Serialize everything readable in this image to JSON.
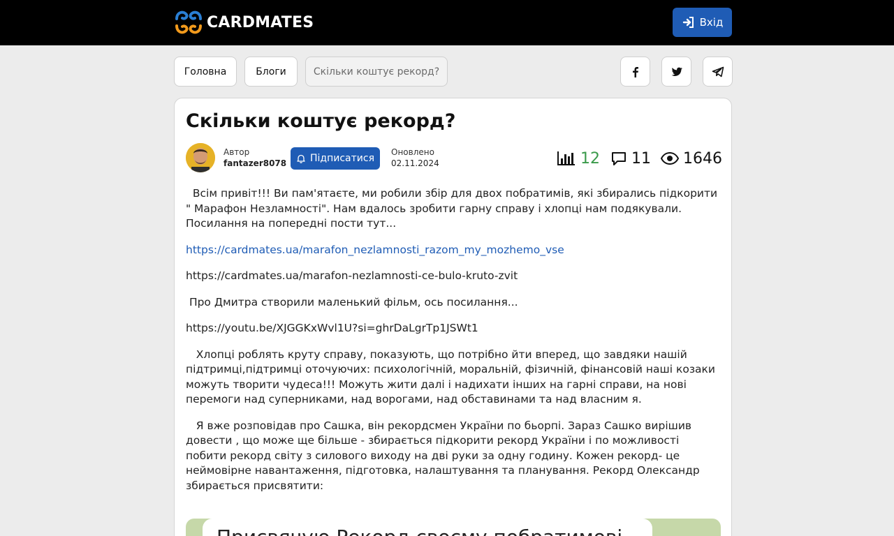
{
  "header": {
    "logo_text": "CARDMATES",
    "login_label": "Вхід"
  },
  "breadcrumbs": [
    {
      "label": "Головна"
    },
    {
      "label": "Блоги"
    },
    {
      "label": "Скільки коштує рекорд?"
    }
  ],
  "share": [
    "facebook-icon",
    "twitter-icon",
    "telegram-icon"
  ],
  "post": {
    "title": "Скільки коштує рекорд?",
    "author_label": "Автор",
    "author_name": "fantazer8078",
    "subscribe_label": "Підписатися",
    "updated_label": "Оновлено",
    "updated_date": "02.11.2024",
    "stats": {
      "rating": "12",
      "comments": "11",
      "views": "1646"
    },
    "paragraphs": [
      "  Всім привіт!!! Ви пам'ятаєте, ми робили збір для двох побратимів, які збирались підкорити \" Марафон Незламності\". Нам вдалось зробити гарну справу і хлопці нам подякували. Посилання на попередні пости тут...",
      "https://cardmates.ua/marafon_nezlamnosti_razom_my_mozhemo_vse",
      "https://cardmates.ua/marafon-nezlamnosti-ce-bulo-kruto-zvit",
      " Про Дмитра створили маленький фільм, ось посилання...",
      "https://youtu.be/XJGGKxWvl1U?si=ghrDaLgrTp1JSWt1",
      "   Хлопці роблять круту справу, показують, що потрібно йти вперед, що завдяки нашій підтримці,підтримці оточуючих: психологічній, моральній, фізичній, фінансовій наші козаки можуть творити чудеса!!! Можуть жити далі і надихати інших на гарні справи, на нові перемоги над суперниками, над ворогами, над обставинами та над власним я.",
      "   Я вже розповідав про Сашка, він рекордсмен України по бьорпі. Зараз Сашко вирішив довести , що може ще більше - збирається підкорити рекорд України і по можливості побити рекорд світу з силового виходу на дві руки за одну годину. Кожен рекорд- це неймовірне навантаження, підготовка, налаштування та планування. Рекорд Олександр збирається присвятити:"
    ],
    "banner_text": "Присвячую Рекорд своєму побратимові"
  },
  "colors": {
    "accent": "#1f5cb5",
    "rating": "#3a9a4a",
    "logo_orange": "#f29a1c",
    "logo_blue": "#2a7fd4"
  }
}
